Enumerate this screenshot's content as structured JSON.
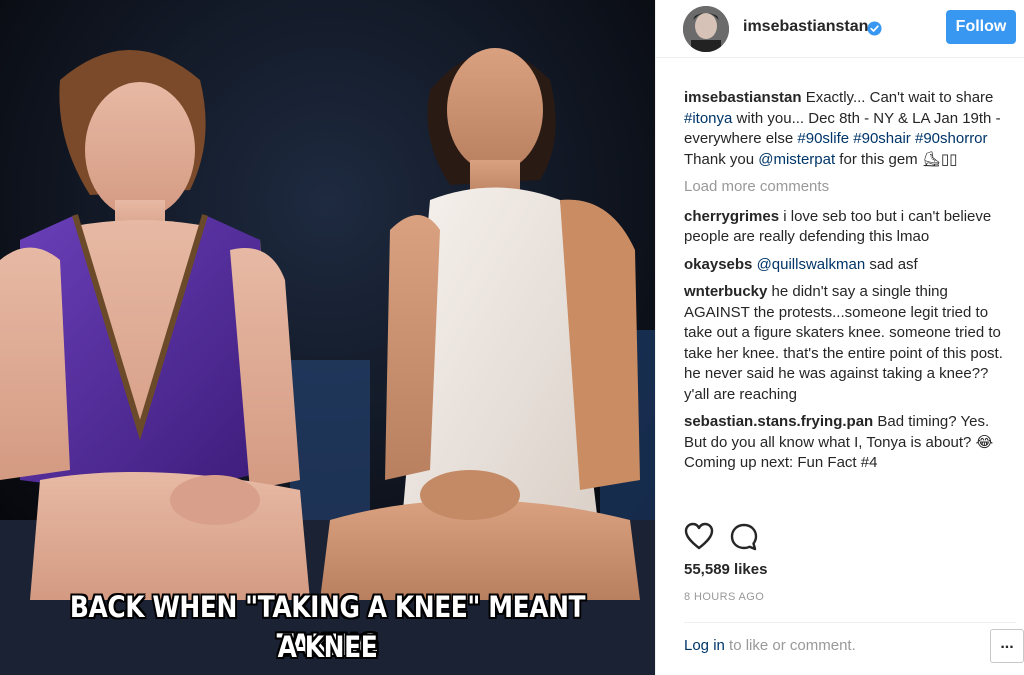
{
  "image": {
    "caption_line1": "BACK WHEN \"TAKING A KNEE\" MEANT TAKING",
    "caption_line2": "A KNEE"
  },
  "header": {
    "username": "imsebastianstan",
    "follow_label": "Follow"
  },
  "post": {
    "user": "imsebastianstan",
    "text_a": " Exactly... Can't wait to share ",
    "tag_itonya": "#itonya",
    "text_b": " with you... Dec 8th - NY & LA Jan 19th - everywhere else ",
    "tag_90slife": "#90slife",
    "tag_90shair": "#90shair",
    "tag_90shorror": "#90shorror",
    "text_c": " Thank you ",
    "mention": "@misterpat",
    "text_d": " for this gem ⛸",
    "text_e": "▯▯"
  },
  "load_more": "Load more comments",
  "comments": [
    {
      "user": "cherrygrimes",
      "text": " i love seb too but i can't believe people are really defending this lmao"
    },
    {
      "user": "okaysebs",
      "mention": "@quillswalkman",
      "text": " sad asf"
    },
    {
      "user": "wnterbucky",
      "text": " he didn't say a single thing AGAINST the protests...someone legit tried to take out a figure skaters knee. someone tried to take her knee. that's the entire point of this post. he never said he was against taking a knee?? y'all are reaching"
    },
    {
      "user": "sebastian.stans.frying.pan",
      "text": " Bad timing? Yes. But do you all know what I, Tonya is about? 😂 Coming up next: Fun Fact #4"
    }
  ],
  "likes": "55,589 likes",
  "time": "8 HOURS AGO",
  "footer": {
    "login_link": "Log in",
    "login_text": " to like or comment.",
    "more_label": "..."
  },
  "colors": {
    "accent": "#3897f0",
    "link": "#003569",
    "muted": "#999999"
  },
  "icons": [
    "verified-badge-icon",
    "heart-icon",
    "comment-bubble-icon",
    "more-options-icon"
  ]
}
